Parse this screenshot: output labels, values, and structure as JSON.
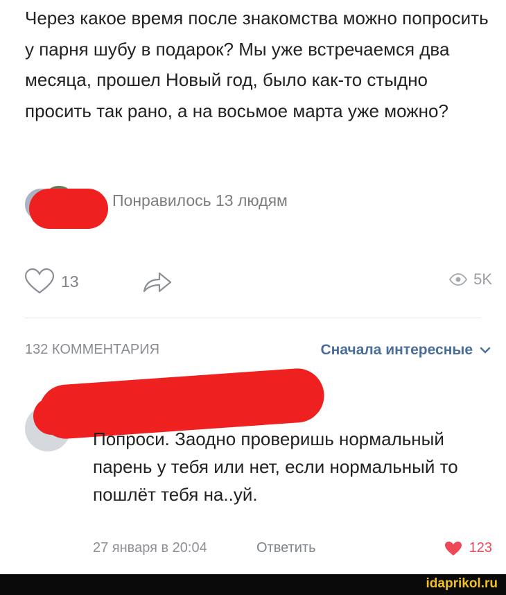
{
  "post": {
    "text": "Через какое время после знакомства можно попросить у парня шубу в подарок? Мы уже встречаемся два месяца, прошел Новый год, было как-то стыдно просить так рано, а на восьмое марта уже можно?",
    "liked_by": "Понравилось 13 людям",
    "like_count": "13",
    "views": "5K"
  },
  "comments": {
    "count_label": "132 КОММЕНТАРИЯ",
    "sort_label": "Сначала интересные",
    "items": [
      {
        "text": "Попроси. Заодно проверишь нормальный парень у тебя или нет, если нормальный то пошлёт тебя на..уй.",
        "date": "27 января в 20:04",
        "reply_label": "Ответить",
        "likes": "123"
      }
    ]
  },
  "watermark": "idaprikol.ru",
  "colors": {
    "redaction": "#ef2020",
    "link": "#4a6e9c",
    "heart": "#ec4858"
  },
  "icons": [
    "heart-outline-icon",
    "share-arrow-icon",
    "eye-icon",
    "chevron-down-icon",
    "heart-filled-icon"
  ]
}
